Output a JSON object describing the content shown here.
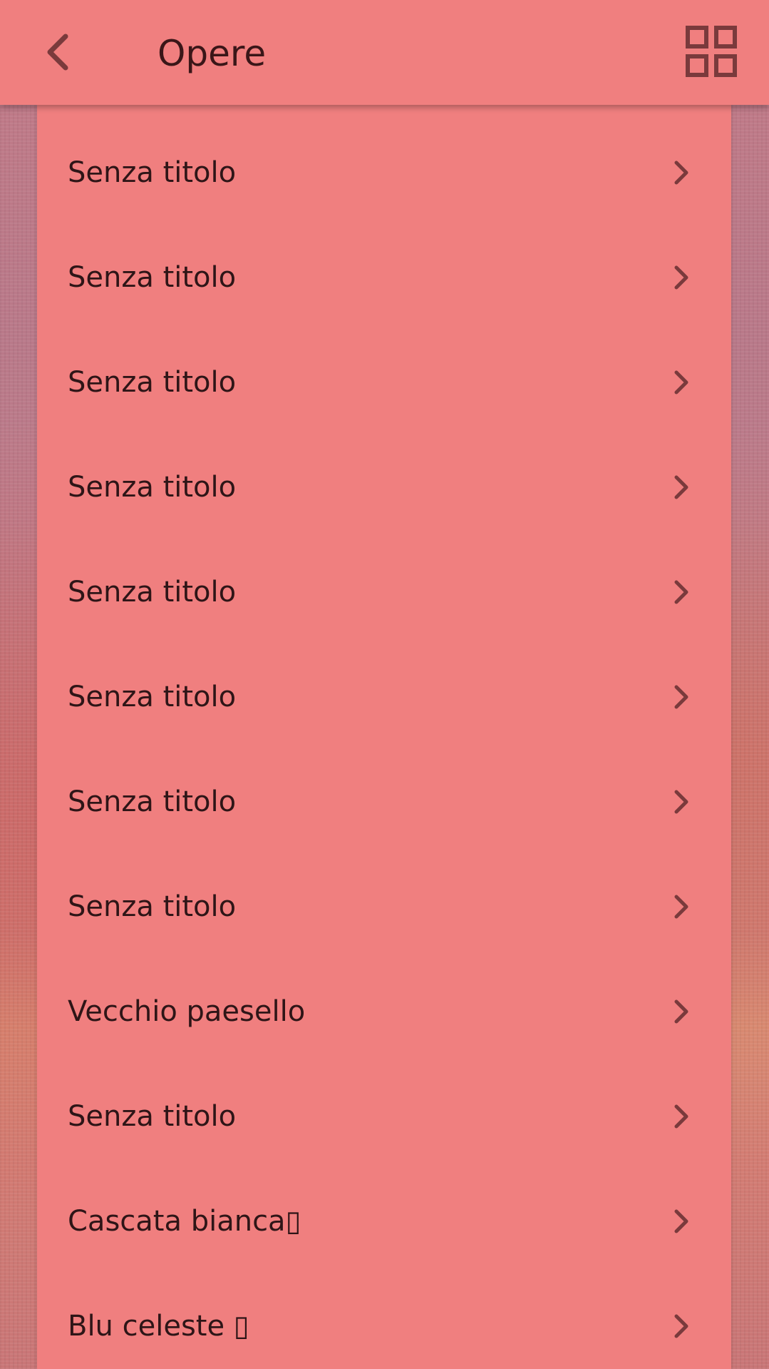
{
  "header": {
    "title": "Opere",
    "back_icon": "chevron-left-icon",
    "view_icon": "grid-view-icon"
  },
  "colors": {
    "bar": "#f07f7f",
    "text": "#2e1517",
    "icon": "#7a3a3c"
  },
  "items": [
    {
      "label": "Senza titolo"
    },
    {
      "label": "Senza titolo"
    },
    {
      "label": "Senza titolo"
    },
    {
      "label": "Senza titolo"
    },
    {
      "label": "Senza titolo"
    },
    {
      "label": "Senza titolo"
    },
    {
      "label": "Senza titolo"
    },
    {
      "label": "Senza titolo"
    },
    {
      "label": "Vecchio paesello"
    },
    {
      "label": "Senza titolo"
    },
    {
      "label": "Cascata bianca▯"
    },
    {
      "label": "Blu celeste ▯"
    }
  ]
}
